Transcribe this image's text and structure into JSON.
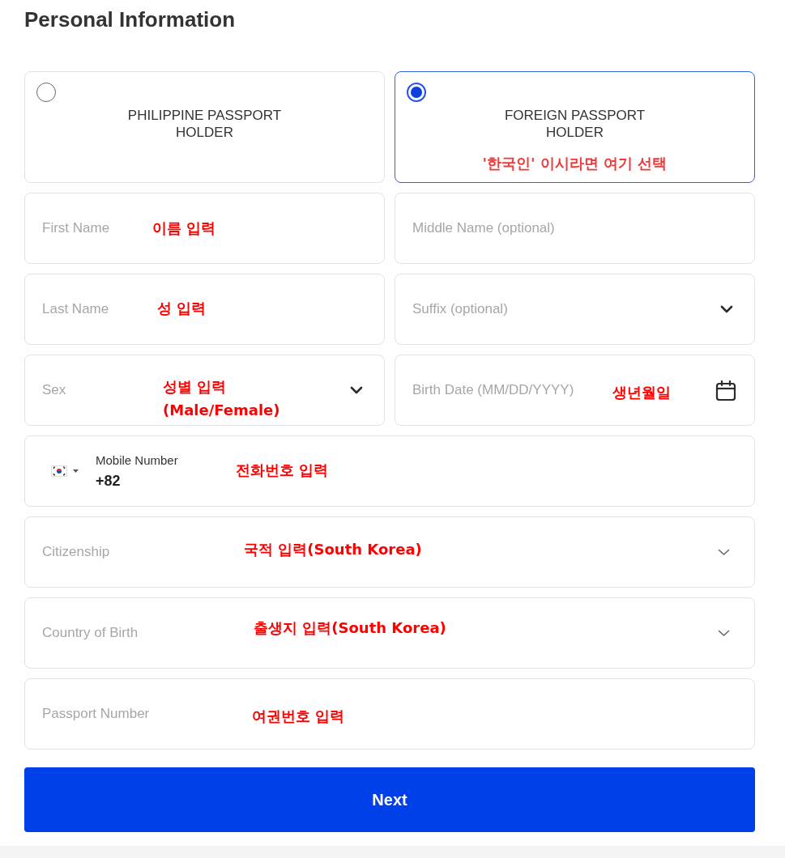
{
  "title": "Personal Information",
  "passport_options": [
    {
      "label": "PHILIPPINE PASSPORT\nHOLDER",
      "selected": false
    },
    {
      "label": "FOREIGN PASSPORT\nHOLDER",
      "selected": true,
      "annotation": "'한국인' 이시라면 여기 선택"
    }
  ],
  "field_rows": [
    [
      {
        "kind": "text",
        "placeholder": "First Name",
        "annotation": "이름 입력"
      },
      {
        "kind": "text",
        "placeholder": "Middle Name (optional)"
      }
    ],
    [
      {
        "kind": "text",
        "placeholder": "Last Name",
        "annotation": "성 입력"
      },
      {
        "kind": "select",
        "placeholder": "Suffix (optional)"
      }
    ],
    [
      {
        "kind": "select",
        "placeholder": "Sex",
        "annotation": "성별 입력\n(Male/Female)"
      },
      {
        "kind": "date",
        "placeholder": "Birth Date (MM/DD/YYYY)",
        "annotation": "생년월일"
      }
    ],
    [
      {
        "kind": "phone",
        "label": "Mobile Number",
        "value": "+82",
        "annotation": "전화번호 입력"
      }
    ],
    [
      {
        "kind": "country",
        "placeholder": "Citizenship",
        "annotation": "국적 입력(South Korea)"
      }
    ],
    [
      {
        "kind": "country",
        "placeholder": "Country of Birth",
        "annotation": "출생지 입력(South Korea)"
      }
    ],
    [
      {
        "kind": "text",
        "placeholder": "Passport Number",
        "annotation": "여권번호 입력"
      }
    ]
  ],
  "next_button": {
    "label": "Next"
  }
}
